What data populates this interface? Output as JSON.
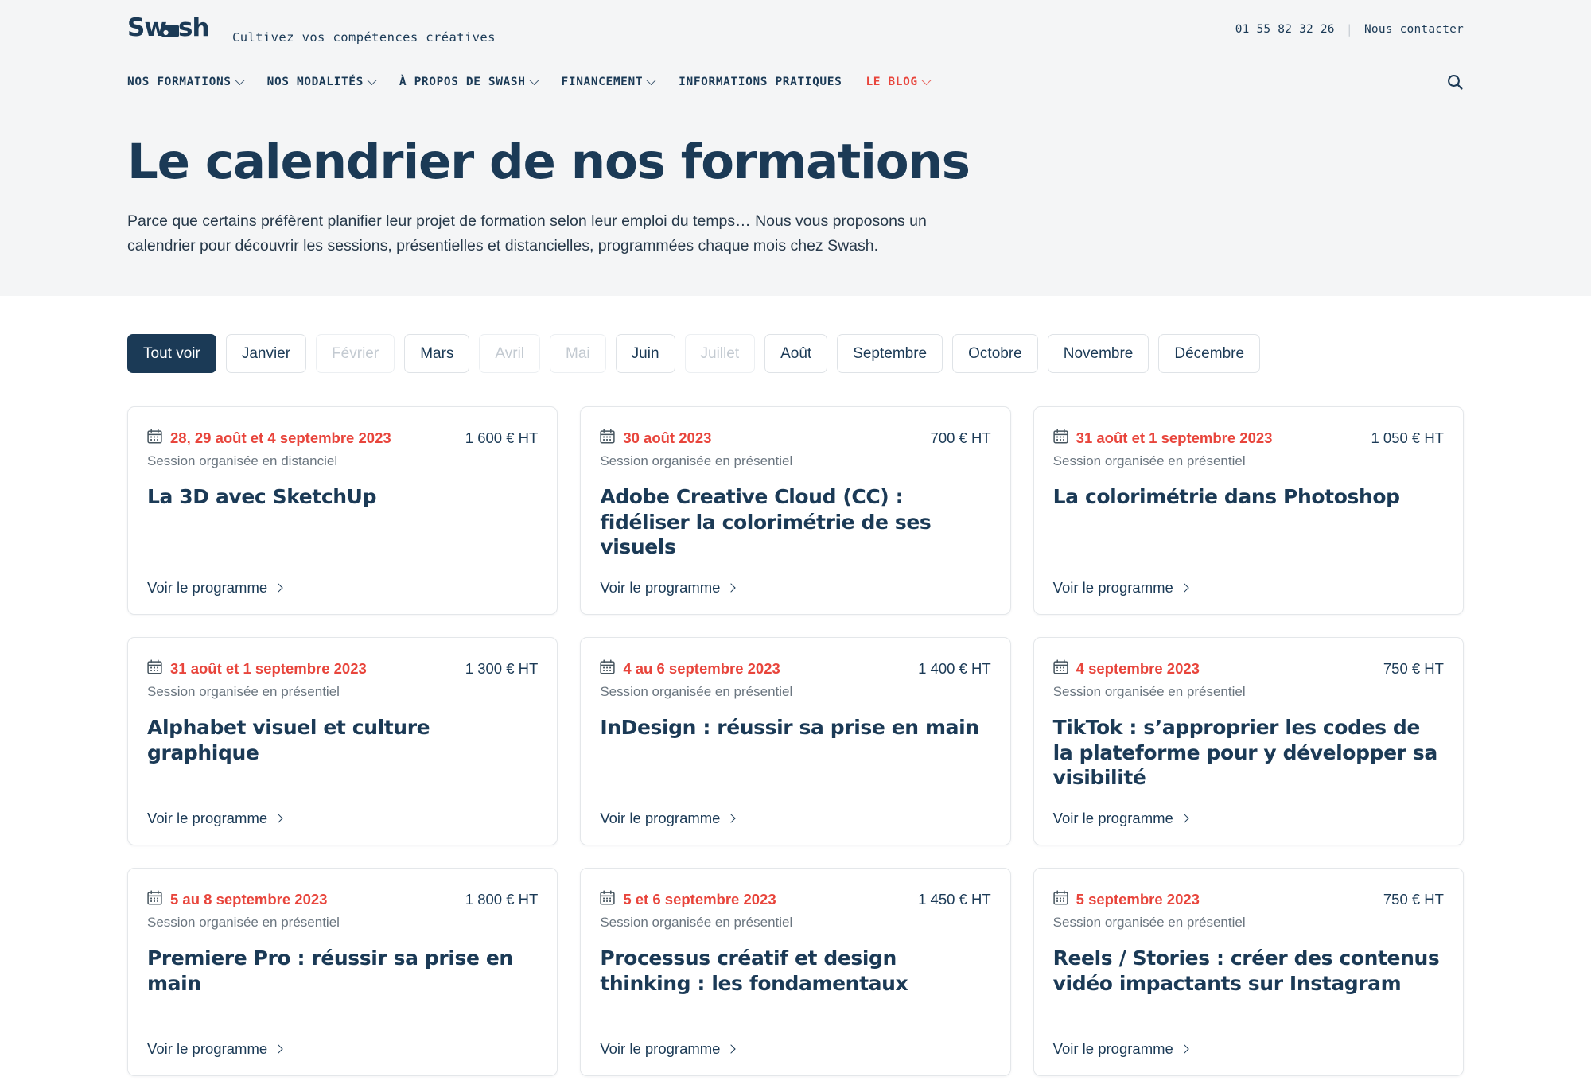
{
  "brand": {
    "name": "Swash",
    "tagline": "Cultivez vos compétences créatives"
  },
  "topbar": {
    "phone": "01 55 82 32 26",
    "separator": "|",
    "contact_label": "Nous contacter"
  },
  "nav": {
    "items": [
      {
        "label": "NOS FORMATIONS",
        "has_dropdown": true,
        "highlight": false
      },
      {
        "label": "NOS MODALITÉS",
        "has_dropdown": true,
        "highlight": false
      },
      {
        "label": "À PROPOS DE SWASH",
        "has_dropdown": true,
        "highlight": false
      },
      {
        "label": "FINANCEMENT",
        "has_dropdown": true,
        "highlight": false
      },
      {
        "label": "INFORMATIONS PRATIQUES",
        "has_dropdown": false,
        "highlight": false
      },
      {
        "label": "LE BLOG",
        "has_dropdown": true,
        "highlight": true
      }
    ],
    "search_icon": "search-icon"
  },
  "hero": {
    "title": "Le calendrier de nos formations",
    "intro_line_1": "Parce que certains préfèrent planifier leur projet de formation selon leur emploi du temps… Nous vous proposons un",
    "intro_line_2": "calendrier pour découvrir les sessions, présentielles et distancielles, programmées chaque mois chez Swash."
  },
  "filters": [
    {
      "label": "Tout voir",
      "state": "active"
    },
    {
      "label": "Janvier",
      "state": "enabled"
    },
    {
      "label": "Février",
      "state": "disabled"
    },
    {
      "label": "Mars",
      "state": "enabled"
    },
    {
      "label": "Avril",
      "state": "disabled"
    },
    {
      "label": "Mai",
      "state": "disabled"
    },
    {
      "label": "Juin",
      "state": "enabled"
    },
    {
      "label": "Juillet",
      "state": "disabled"
    },
    {
      "label": "Août",
      "state": "enabled"
    },
    {
      "label": "Septembre",
      "state": "enabled"
    },
    {
      "label": "Octobre",
      "state": "enabled"
    },
    {
      "label": "Novembre",
      "state": "enabled"
    },
    {
      "label": "Décembre",
      "state": "enabled"
    }
  ],
  "card_link_label": "Voir le programme",
  "cards": [
    {
      "date": "28, 29 août et 4 septembre 2023",
      "price": "1 600 € HT",
      "mode": "Session organisée en distanciel",
      "title": "La 3D avec SketchUp"
    },
    {
      "date": "30 août 2023",
      "price": "700 € HT",
      "mode": "Session organisée en présentiel",
      "title": "Adobe Creative Cloud (CC) : fidéliser la colorimétrie de ses visuels"
    },
    {
      "date": "31 août et 1 septembre 2023",
      "price": "1 050 € HT",
      "mode": "Session organisée en présentiel",
      "title": "La colorimétrie dans Photoshop"
    },
    {
      "date": "31 août et 1 septembre 2023",
      "price": "1 300 € HT",
      "mode": "Session organisée en présentiel",
      "title": "Alphabet visuel et culture graphique"
    },
    {
      "date": "4 au 6 septembre 2023",
      "price": "1 400 € HT",
      "mode": "Session organisée en présentiel",
      "title": "InDesign : réussir sa prise en main"
    },
    {
      "date": "4 septembre 2023",
      "price": "750 € HT",
      "mode": "Session organisée en présentiel",
      "title": "TikTok : s’approprier les codes de la plateforme pour y développer sa visibilité"
    },
    {
      "date": "5 au 8 septembre 2023",
      "price": "1 800 € HT",
      "mode": "Session organisée en présentiel",
      "title": "Premiere Pro : réussir sa prise en main"
    },
    {
      "date": "5 et 6 septembre 2023",
      "price": "1 450 € HT",
      "mode": "Session organisée en présentiel",
      "title": "Processus créatif et design thinking : les fondamentaux"
    },
    {
      "date": "5 septembre 2023",
      "price": "750 € HT",
      "mode": "Session organisée en présentiel",
      "title": "Reels / Stories : créer des contenus vidéo impactants sur Instagram"
    }
  ],
  "colors": {
    "navy": "#1b3a56",
    "red": "#e8453c",
    "hero_bg": "#f4f5f6",
    "grey_text": "#6b7680"
  }
}
